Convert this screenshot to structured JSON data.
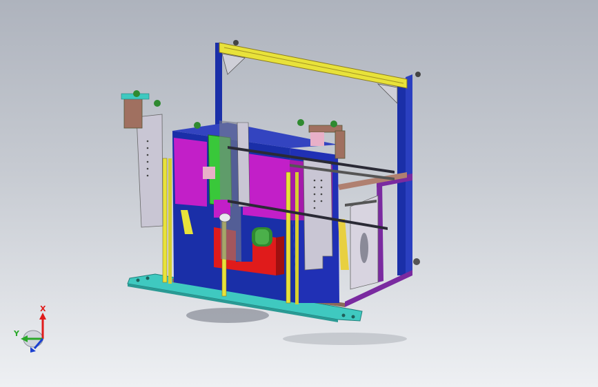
{
  "viewport": {
    "background_top": "#aeb3bd",
    "background_bottom": "#eef0f3"
  },
  "model": {
    "description_icon": "machine-frame-assembly",
    "colors": {
      "frame_blue": "#1a2fa8",
      "rail_yellow": "#e8e23a",
      "panel_magenta": "#c21fc8",
      "base_cyan": "#3fc9c0",
      "block_green": "#39c83a",
      "block_red": "#e01b1b",
      "plate_gray": "#c9c6d4",
      "bracket_brown": "#a07060",
      "strip_purple": "#7a2aa0"
    }
  },
  "triad": {
    "x_label": "X",
    "y_label": "Y",
    "x_color": "#e01b1b",
    "y_color": "#2aa82a",
    "z_color": "#1a3fd0"
  }
}
